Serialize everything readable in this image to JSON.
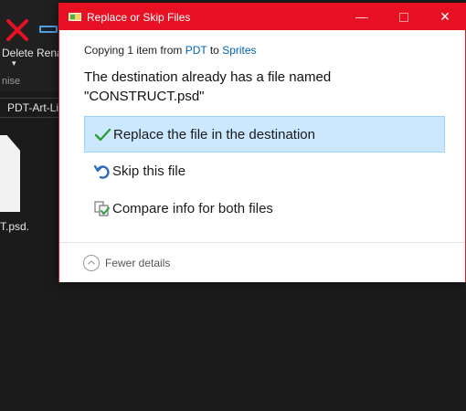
{
  "background": {
    "ribbon": {
      "delete_label": "Delete",
      "rename_label": "Rena",
      "organise_label": "nise"
    },
    "address_segment": "PDT-Art-Li",
    "file_label": "T.psd."
  },
  "dialog": {
    "title": "Replace or Skip Files",
    "minimize_glyph": "—",
    "close_glyph": "✕",
    "copy_status": {
      "prefix": "Copying 1 item from ",
      "source": "PDT",
      "connector": " to ",
      "destination": "Sprites"
    },
    "message_line1": "The destination already has a file named",
    "message_line2": "\"CONSTRUCT.psd\"",
    "options": [
      {
        "label": "Replace the file in the destination",
        "icon": "checkmark-icon"
      },
      {
        "label": "Skip this file",
        "icon": "skip-icon"
      },
      {
        "label": "Compare info for both files",
        "icon": "compare-icon"
      }
    ],
    "footer_label": "Fewer details"
  },
  "colors": {
    "accent": "#e81123",
    "selection": "#cce8ff",
    "link": "#0063b1",
    "check": "#2e9e3a",
    "skip": "#2b6cc4"
  }
}
